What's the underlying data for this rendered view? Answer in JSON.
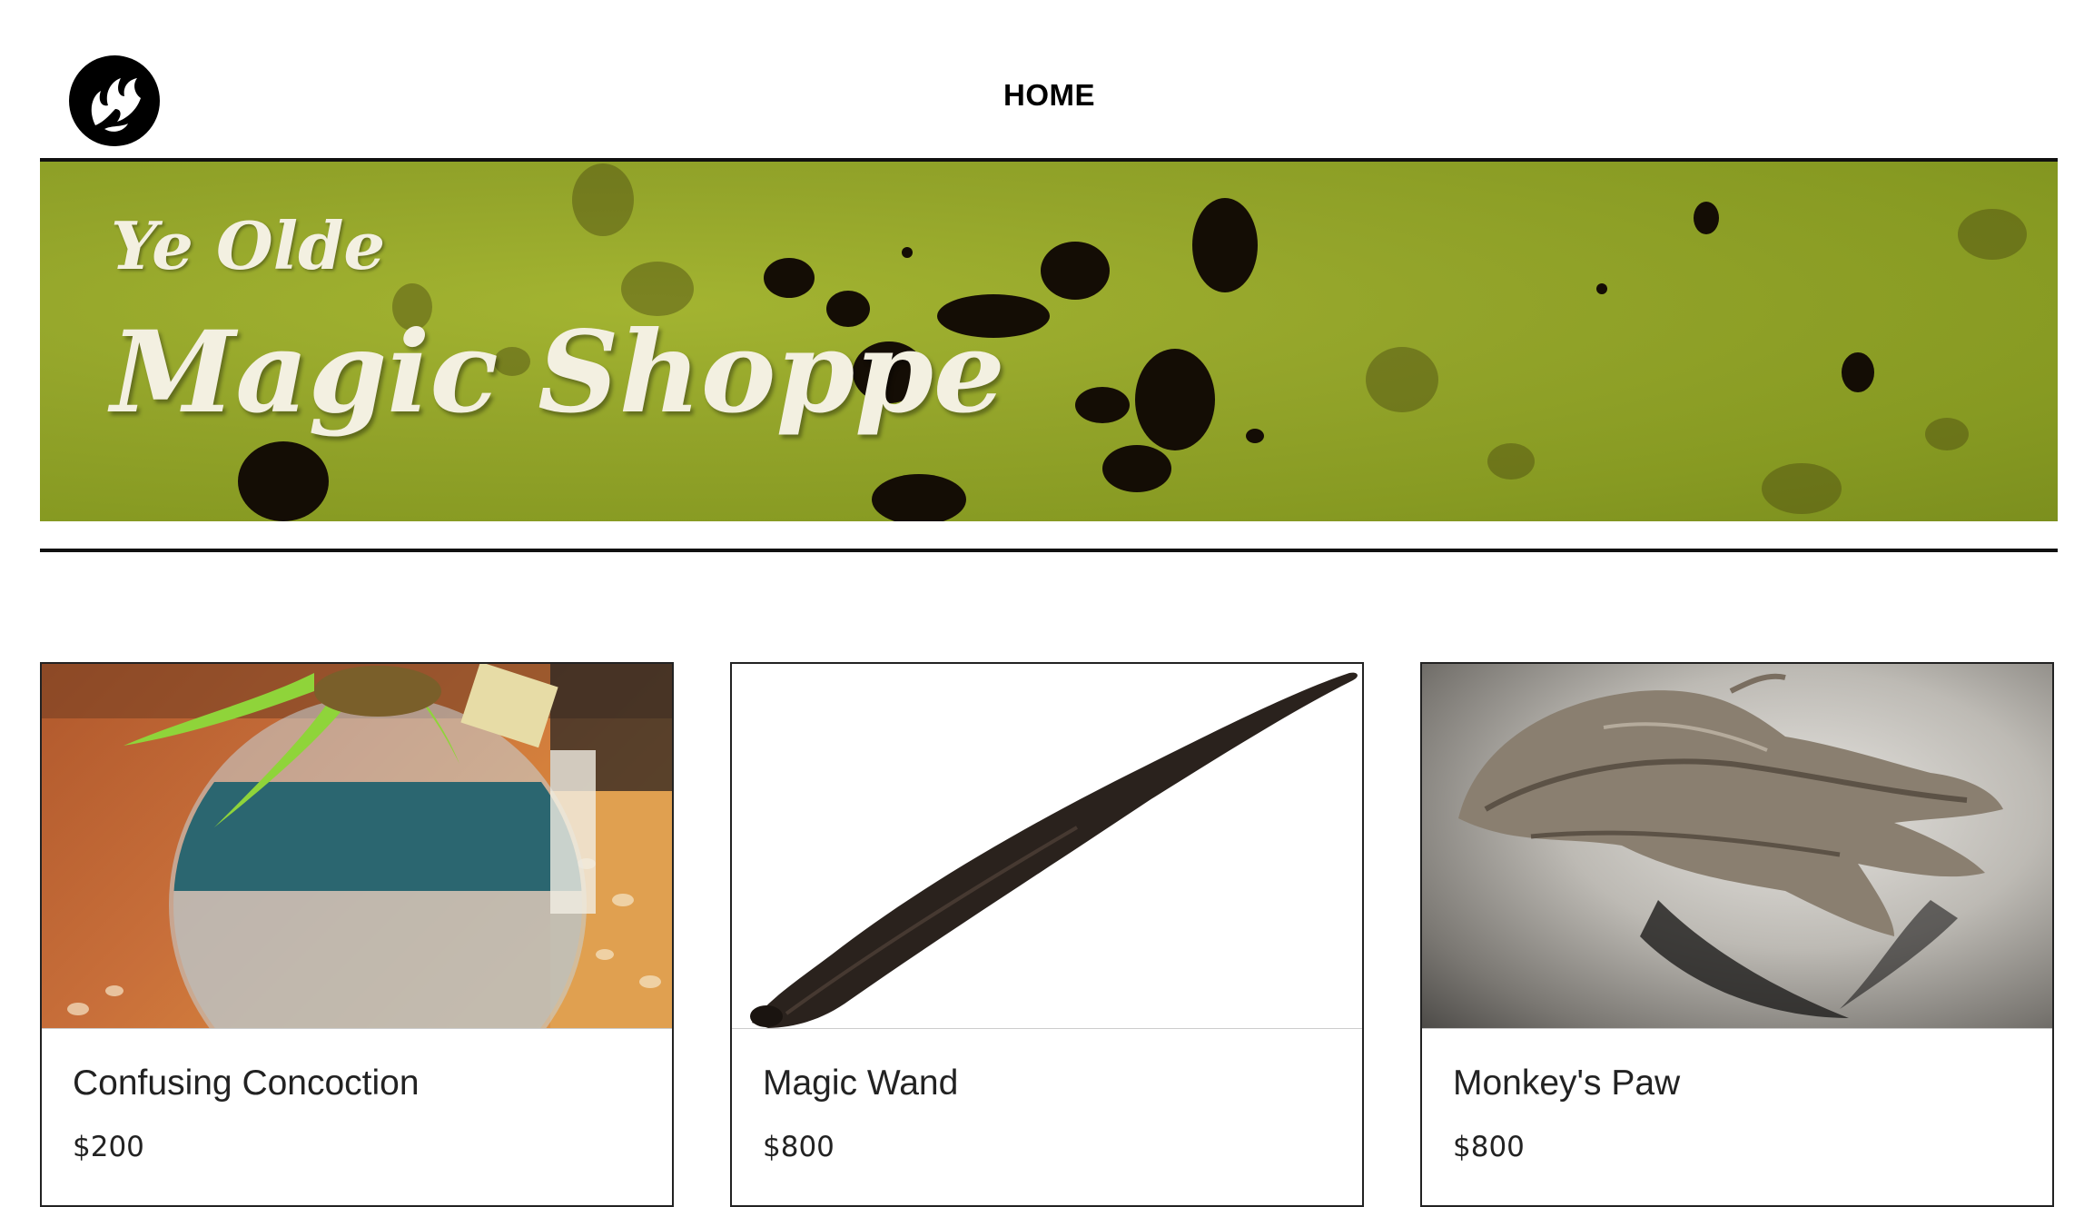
{
  "header": {
    "logo_icon": "dragon-emblem-icon",
    "nav": {
      "home_label": "HOME"
    }
  },
  "banner": {
    "title_small": "Ye Olde",
    "title_big": "Magic Shoppe"
  },
  "products": [
    {
      "name": "Confusing Concoction",
      "price": "$200",
      "image_icon": "potion-bottle-image"
    },
    {
      "name": "Magic Wand",
      "price": "$800",
      "image_icon": "wand-image"
    },
    {
      "name": "Monkey's Paw",
      "price": "$800",
      "image_icon": "monkey-paw-image"
    }
  ],
  "colors": {
    "banner_green": "#8fa126",
    "rule": "#111111",
    "text": "#222222"
  }
}
